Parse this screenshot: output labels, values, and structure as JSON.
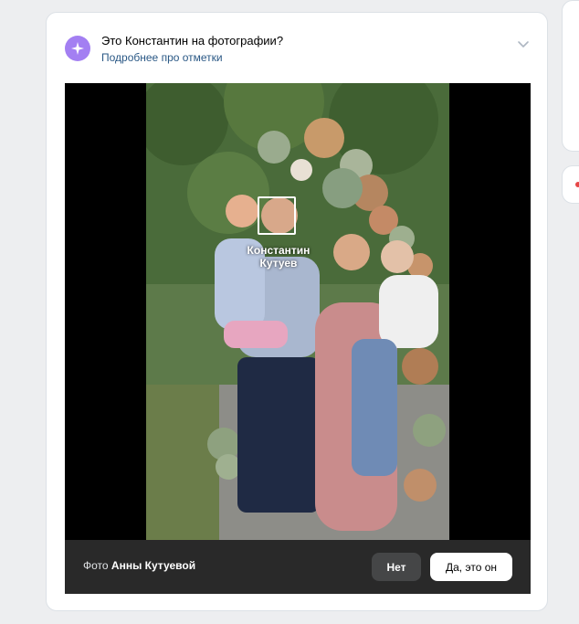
{
  "prompt": {
    "title": "Это Константин на фотографии?",
    "more_link": "Подробнее про отметки",
    "icon": "sparkle-icon"
  },
  "photo": {
    "tag_name": "Константин Кутуев"
  },
  "footer": {
    "credit_prefix": "Фото",
    "credit_author": "Анны Кутуевой",
    "no_label": "Нет",
    "yes_label": "Да, это он"
  },
  "colors": {
    "accent": "#a37ff2",
    "link": "#2a5885",
    "bar": "#292929"
  }
}
